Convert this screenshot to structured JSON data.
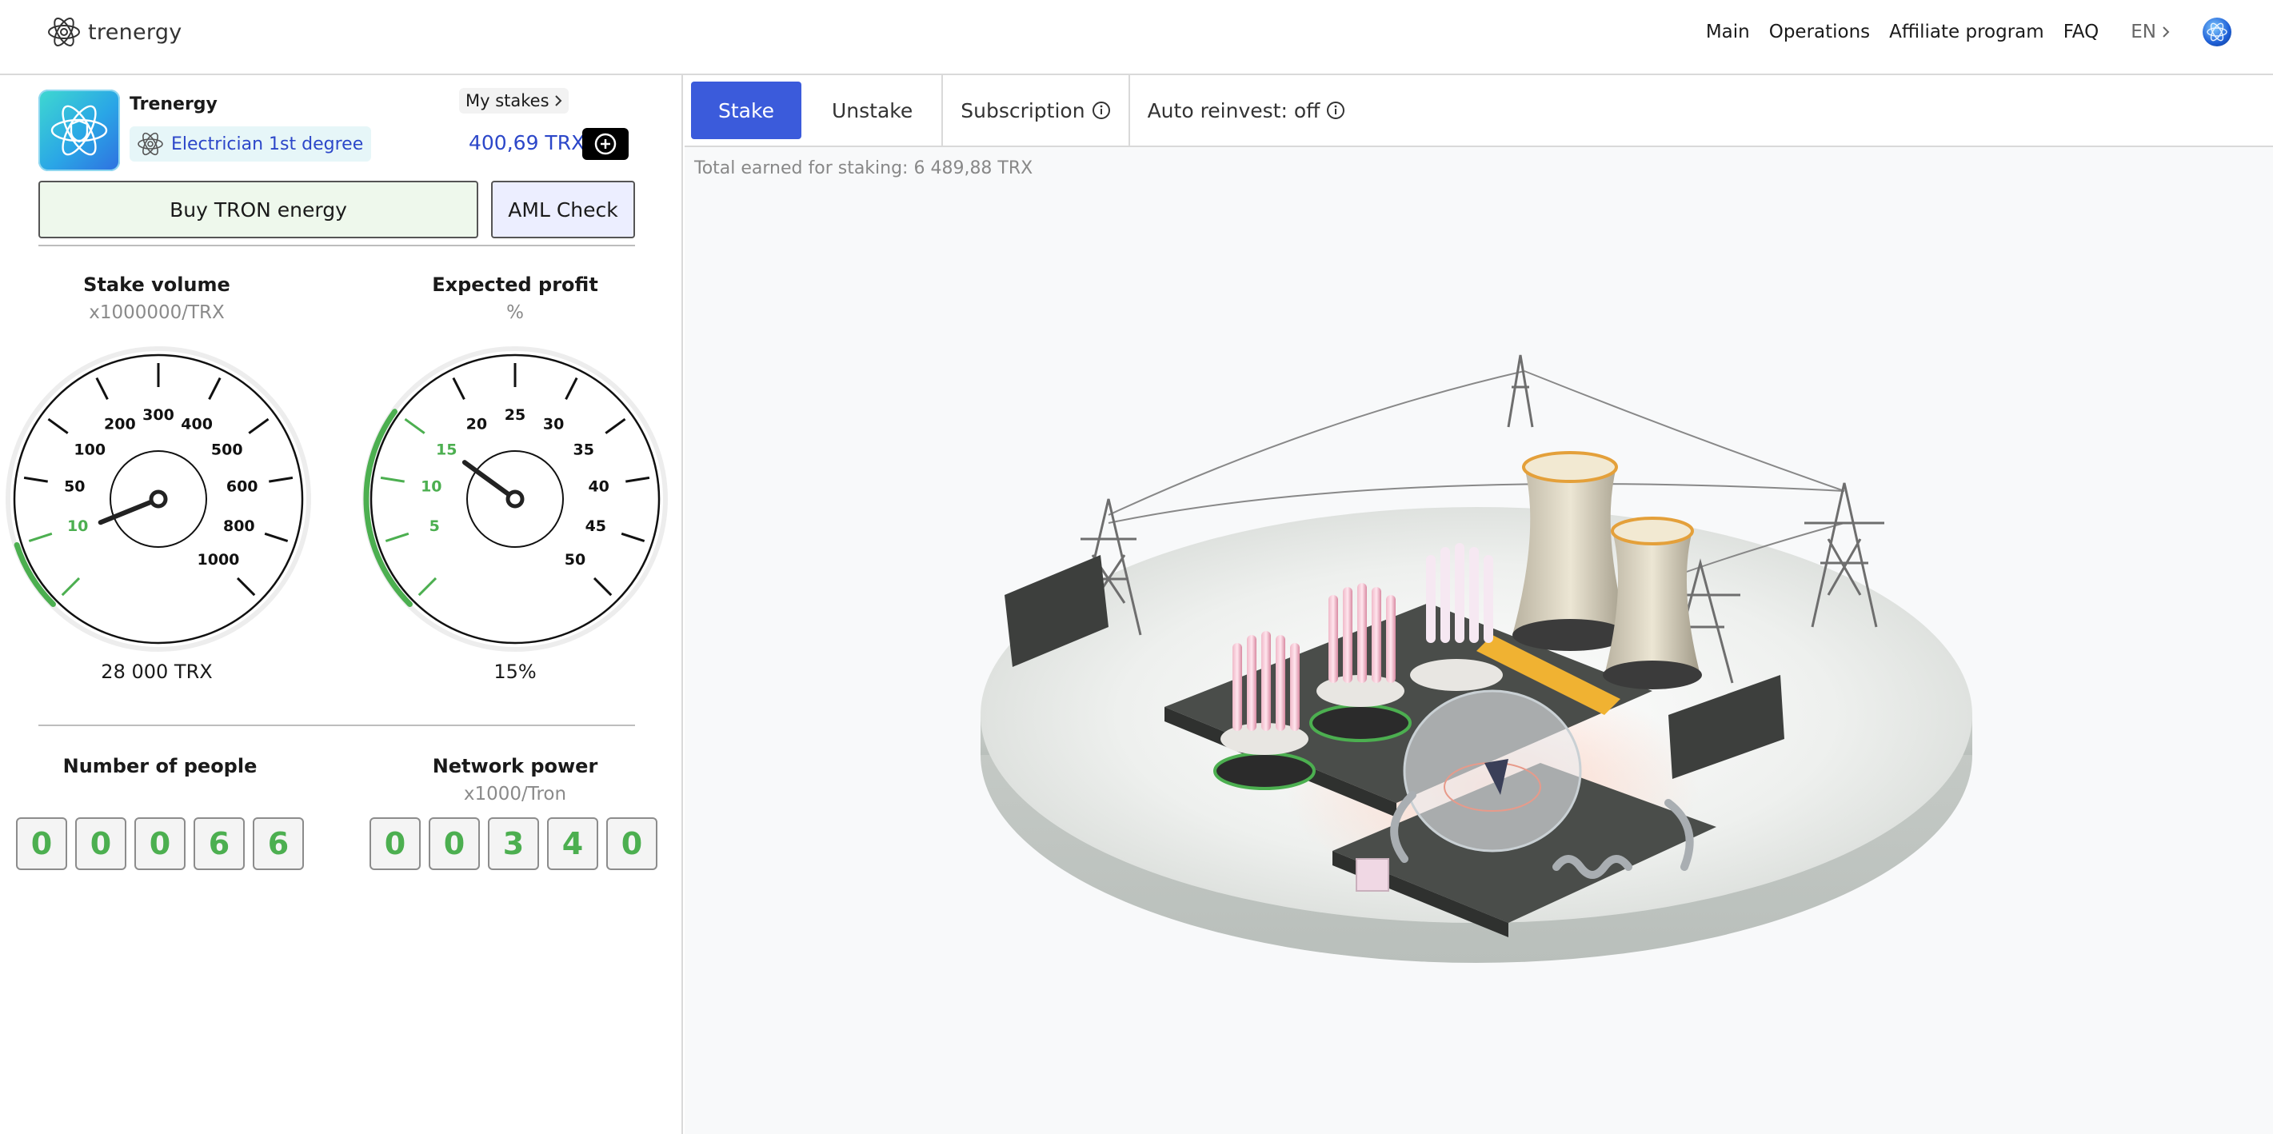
{
  "header": {
    "logo_text": "trenergy",
    "nav": [
      "Main",
      "Operations",
      "Affiliate program",
      "FAQ"
    ],
    "lang": "EN"
  },
  "profile": {
    "name": "Trenergy",
    "rank": "Electrician 1st degree",
    "my_stakes": "My stakes",
    "balance": "400,69 TRX"
  },
  "actions": {
    "buy": "Buy TRON energy",
    "aml": "AML Check"
  },
  "stake_gauge": {
    "title": "Stake volume",
    "unit": "x1000000/TRX",
    "value_text": "28 000 TRX",
    "ticks": [
      "10",
      "50",
      "100",
      "200",
      "300",
      "400",
      "500",
      "600",
      "800",
      "1000"
    ],
    "needle_index": 0.35
  },
  "profit_gauge": {
    "title": "Expected profit",
    "unit": "%",
    "value_text": "15%",
    "ticks": [
      "5",
      "10",
      "15",
      "20",
      "25",
      "30",
      "35",
      "40",
      "45",
      "50"
    ],
    "needle_value": 15
  },
  "people": {
    "title": "Number of people",
    "digits": [
      "0",
      "0",
      "0",
      "6",
      "6"
    ]
  },
  "network": {
    "title": "Network power",
    "unit": "x1000/Tron",
    "digits": [
      "0",
      "0",
      "3",
      "4",
      "0"
    ]
  },
  "tabs": {
    "stake": "Stake",
    "unstake": "Unstake",
    "subscription": "Subscription",
    "auto_reinvest": "Auto reinvest: off"
  },
  "earned": "Total earned for staking: 6 489,88 TRX",
  "colors": {
    "accent": "#3b5bdb",
    "green": "#4caf50",
    "balance": "#2c47c9"
  }
}
